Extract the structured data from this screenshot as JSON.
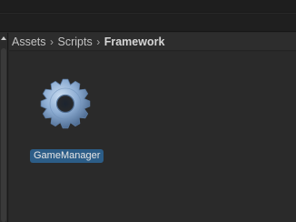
{
  "breadcrumb": [
    {
      "label": "Assets"
    },
    {
      "label": "Scripts"
    },
    {
      "label": "Framework"
    }
  ],
  "separator": "›",
  "assets": [
    {
      "name": "GameManager",
      "icon": "gear-icon",
      "selected": true
    }
  ],
  "colors": {
    "selection": "#2c5d87",
    "gear_light": "#a9c2de",
    "gear_dark": "#3f5c82"
  }
}
